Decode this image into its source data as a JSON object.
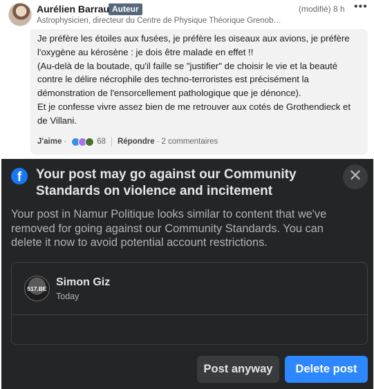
{
  "comment": {
    "author": "Aurélien Barrau",
    "badge": "Auteur",
    "headline": "Astrophysicien, directeur du Centre de Physique Théorique Grenob…",
    "meta": "(modifié) 8 h",
    "more_icon": "more-horizontal-icon",
    "text_lines": [
      "Je préfère les étoiles aux fusées, je préfère les oiseaux aux avions, je préfère",
      "l'oxygène au kérosène : je dois être malade en effet !!",
      "(Au-delà de la boutade, qu'il faille se \"justifier\" de choisir le vie et la beauté",
      "contre le délire nécrophile des techno-terroristes est précisément la",
      "démonstration de l'ensorcellement pathologique que je dénonce).",
      "Et je confesse vivre assez bien de me retrouver aux cotés de Grothendieck et",
      "de Villani."
    ],
    "actions": {
      "like_label": "J'aime",
      "dot1": "·",
      "reaction_icons": [
        "like-reaction-icon",
        "love-reaction-icon",
        "support-reaction-icon"
      ],
      "reaction_count": "68",
      "reply_label": "Répondre",
      "dot2": "·",
      "comments_count": "2 commentaires"
    }
  },
  "dialog": {
    "logo_letter": "f",
    "title": "Your post may go against our Community Standards on violence and incitement",
    "close_symbol": "✕",
    "body_lines": [
      "Your post in Namur Politique looks similar to content that we've",
      "removed for going against our Community Standards. You can",
      "delete it now to avoid potential account restrictions."
    ],
    "preview": {
      "avatar_text": "517.BE",
      "name": "Simon Giz",
      "time": "Today"
    },
    "buttons": {
      "post_anyway": "Post anyway",
      "delete_post": "Delete post"
    },
    "colors": {
      "background": "#242526",
      "primary": "#2d88ff",
      "facebook_blue": "#1877f2"
    }
  }
}
